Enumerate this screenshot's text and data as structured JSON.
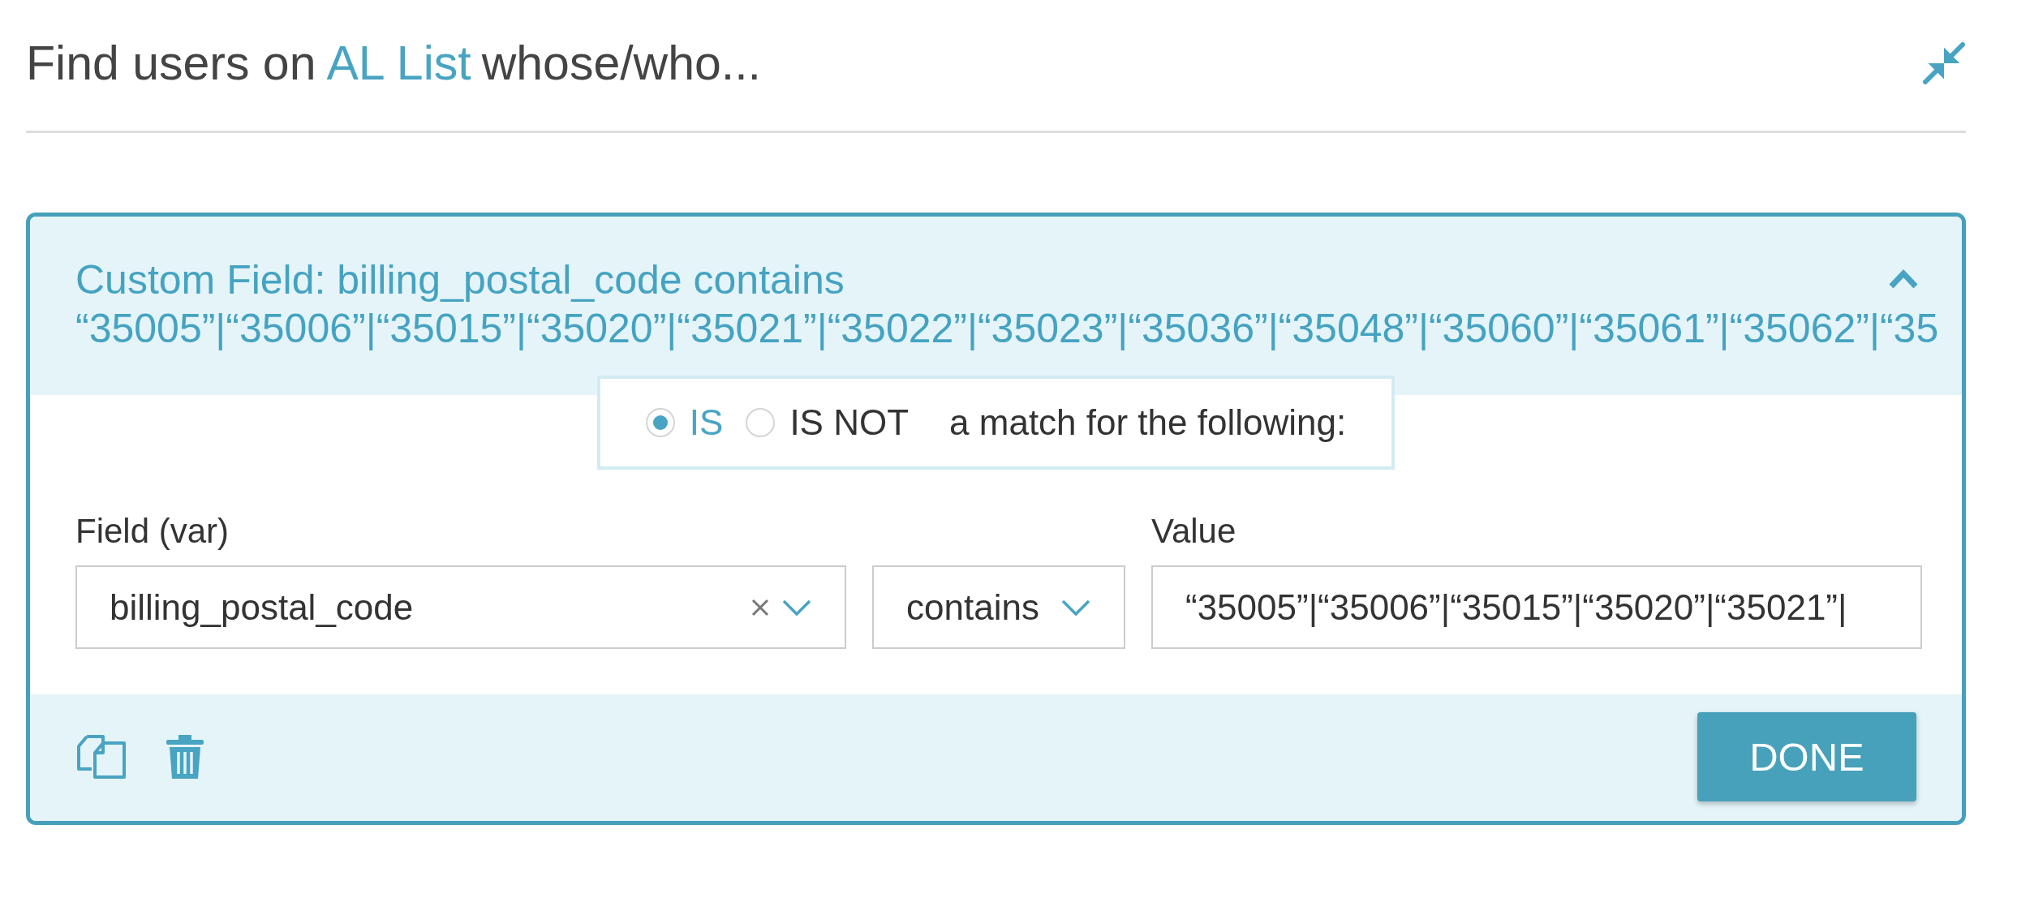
{
  "heading": {
    "prefix": "Find users on",
    "list_link": "AL List",
    "suffix": "whose/who..."
  },
  "rule": {
    "summary_line_1": "Custom Field: billing_postal_code contains",
    "summary_line_2": "“35005”|“35006”|“35015”|“35020”|“35021”|“35022”|“35023”|“35036”|“35048”|“35060”|“35061”|“35062”|“35",
    "expanded": true,
    "match_options": [
      {
        "label": "IS",
        "selected": true
      },
      {
        "label": "IS NOT",
        "selected": false
      }
    ],
    "match_suffix": "a match for the following:",
    "field_label": "Field (var)",
    "field_value": "billing_postal_code",
    "operator_value": "contains",
    "value_label": "Value",
    "value_value": "“35005”|“35006”|“35015”|“35020”|“35021”|",
    "done_button": "DONE"
  }
}
